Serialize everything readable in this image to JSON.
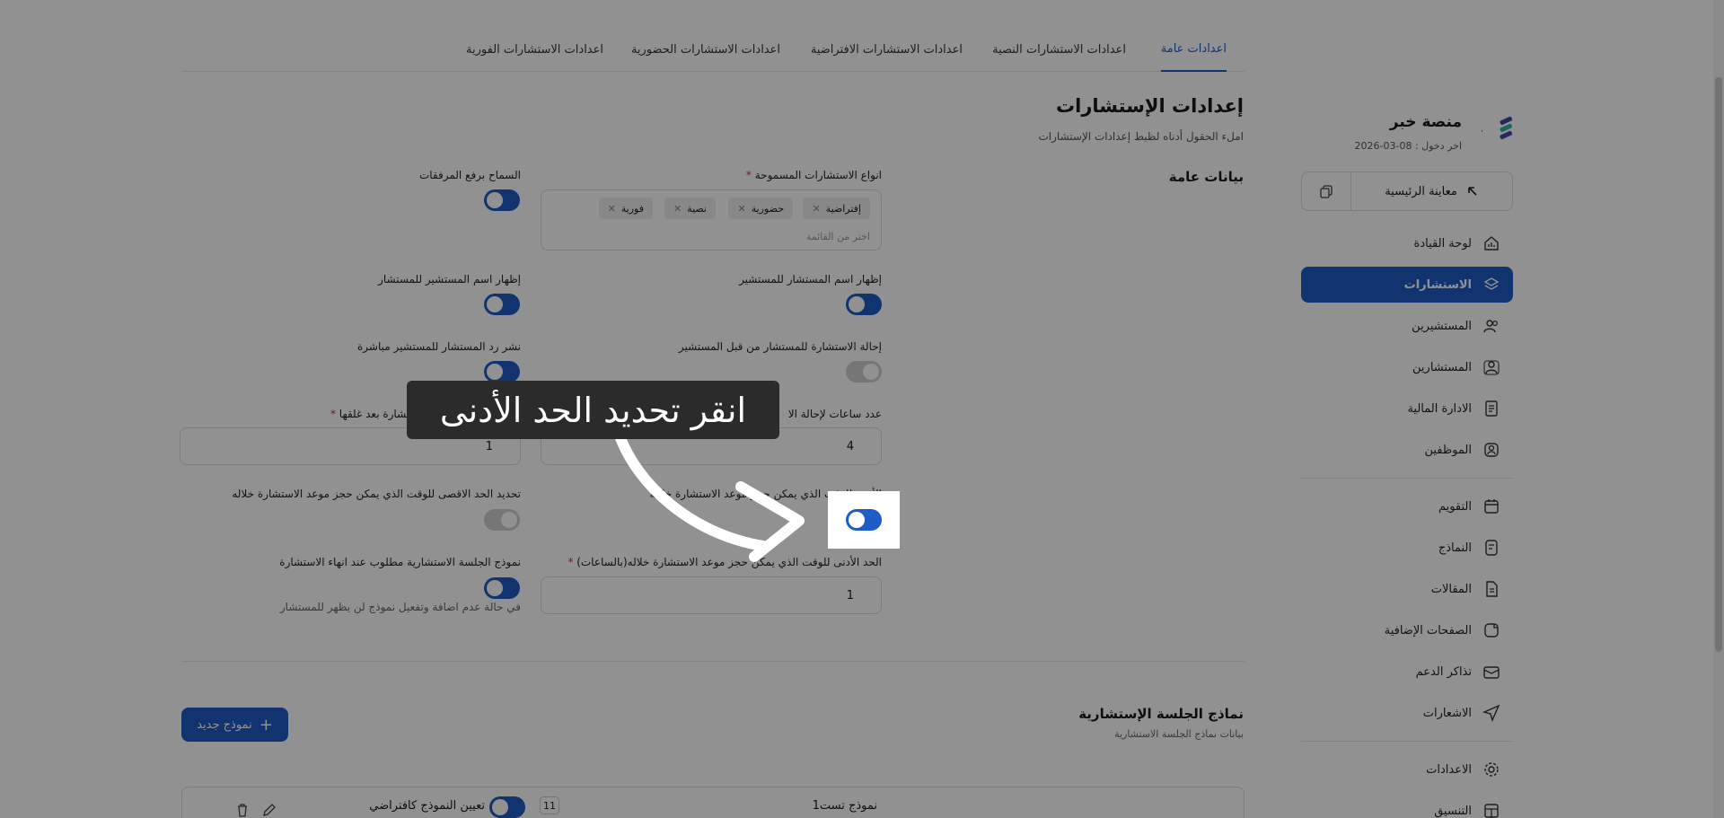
{
  "sidebar": {
    "org_name": "منصة خبر",
    "last_login": "اخر دخول : 08-03-2026",
    "preview_label": "معاينة الرئيسية",
    "items": [
      {
        "label": "لوحة القيادة",
        "icon": "dashboard-icon"
      },
      {
        "label": "الاستشارات",
        "icon": "layers-icon",
        "active": true
      },
      {
        "label": "المستشيرين",
        "icon": "users-icon"
      },
      {
        "label": "المستشارين",
        "icon": "consultant-icon"
      },
      {
        "label": "الادارة المالية",
        "icon": "finance-icon"
      },
      {
        "label": "الموظفين",
        "icon": "employee-icon"
      },
      {
        "label": "التقويم",
        "icon": "calendar-icon"
      },
      {
        "label": "النماذج",
        "icon": "forms-icon"
      },
      {
        "label": "المقالات",
        "icon": "articles-icon"
      },
      {
        "label": "الصفحات الإضافية",
        "icon": "pages-icon"
      },
      {
        "label": "تذاكر الدعم",
        "icon": "ticket-icon"
      },
      {
        "label": "الاشعارات",
        "icon": "send-icon"
      },
      {
        "label": "الاعدادات",
        "icon": "gear-icon"
      },
      {
        "label": "التنسيق",
        "icon": "layout-icon"
      }
    ]
  },
  "tabs": [
    {
      "label": "اعدادات عامة",
      "active": true
    },
    {
      "label": "اعدادات الاستشارات النصية"
    },
    {
      "label": "اعدادات الاستشارات الافتراضية"
    },
    {
      "label": "اعدادات الاستشارات الحضورية"
    },
    {
      "label": "اعدادات الاستشارات الفورية"
    }
  ],
  "page": {
    "title": "إعدادات الإستشارات",
    "subtitle": "املء الحقول أدناه لظبط إعدادات الإستشارات",
    "section": "بيانات عامة"
  },
  "form": {
    "allowed_types_label": "انواع الاستشارات المسموحة",
    "required_mark": "*",
    "allowed_types": [
      "إفتراضية",
      "حضورية",
      "نصية",
      "فورية"
    ],
    "allowed_types_hint": "اختر من القائمة",
    "allow_attachments": "السماح برفع المرفقات",
    "show_consultant_name": "إظهار اسم المستشار للمستشير",
    "show_client_name": "إظهار اسم المستشير للمستشار",
    "transfer_consultation": "إحالة الاستشارة للمستشار من قبل المستشير",
    "publish_reply": "نشر رد المستشار للمستشير مباشرة",
    "hours_transfer_label": "عدد ساعات لإحالة الا",
    "hours_transfer_value": "4",
    "reopen_label": "المسموح لإعادة فتح الاستشارة بعد غلقها",
    "reopen_value": "1",
    "min_time_toggle": "الأدنى للوقت الذي يمكن حجز موعد الاستشارة خلاله",
    "max_time_toggle": "تحديد الحد الاقصى للوقت الذي يمكن حجز موعد الاستشارة خلاله",
    "min_time_label": "الحد الأدنى للوقت الذي يمكن حجز موعد الاستشارة خلاله(بالساعات)",
    "min_time_value": "1",
    "session_model_required": "نموذج الجلسة الاستشارية مطلوب عند انهاء الاستشارة",
    "session_model_hint": "في حالة عدم اضافة وتفعيل نموذج لن يظهر للمستشار"
  },
  "models": {
    "title": "نماذج الجلسة الإستشارية",
    "subtitle": "بيانات نماذج الجلسة الاستشارية",
    "new_button": "نموذج جديد",
    "rows": [
      {
        "name": "نموذج تست1",
        "badge": "11",
        "default_label": "تعيين النموذج كافتراضي"
      }
    ]
  },
  "tooltip": {
    "text": "انقر تحديد الحد الأدنى"
  },
  "colors": {
    "accent": "#1e5cc7",
    "overlay": "rgba(0,0,0,0.43)"
  }
}
